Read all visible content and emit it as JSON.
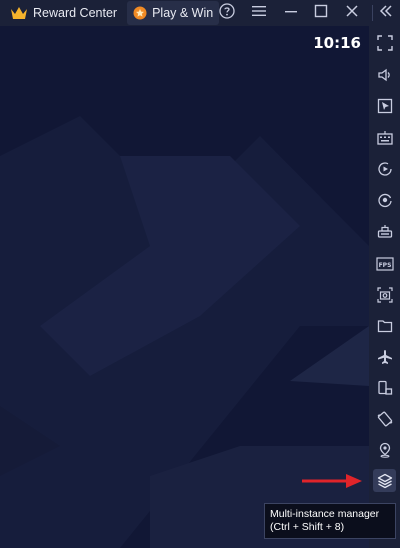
{
  "topbar": {
    "reward_center_label": "Reward Center",
    "play_win_label": "Play & Win",
    "icons": [
      "crown-icon",
      "play-win-icon",
      "help-icon",
      "menu-icon",
      "minimize-icon",
      "maximize-icon",
      "close-icon",
      "collapse-sidebar-icon"
    ]
  },
  "screen": {
    "clock": "10:16"
  },
  "sidebar": {
    "items": [
      {
        "name": "fullscreen"
      },
      {
        "name": "volume"
      },
      {
        "name": "media-manager"
      },
      {
        "name": "keyboard-controls"
      },
      {
        "name": "macro-recorder"
      },
      {
        "name": "sync"
      },
      {
        "name": "game-controls"
      },
      {
        "name": "fps"
      },
      {
        "name": "screenshot"
      },
      {
        "name": "file-manager"
      },
      {
        "name": "airplane-mode"
      },
      {
        "name": "rotate"
      },
      {
        "name": "shake"
      },
      {
        "name": "location"
      },
      {
        "name": "multi-instance-manager"
      }
    ]
  },
  "tooltip": {
    "line1": "Multi-instance manager",
    "line2": "(Ctrl + Shift + 8)"
  },
  "colors": {
    "topbar_bg": "#1b2138",
    "screen_bg": "#111735",
    "accent_crown": "#f5b32c",
    "accent_play": "#f08a24",
    "arrow": "#e0242a"
  }
}
